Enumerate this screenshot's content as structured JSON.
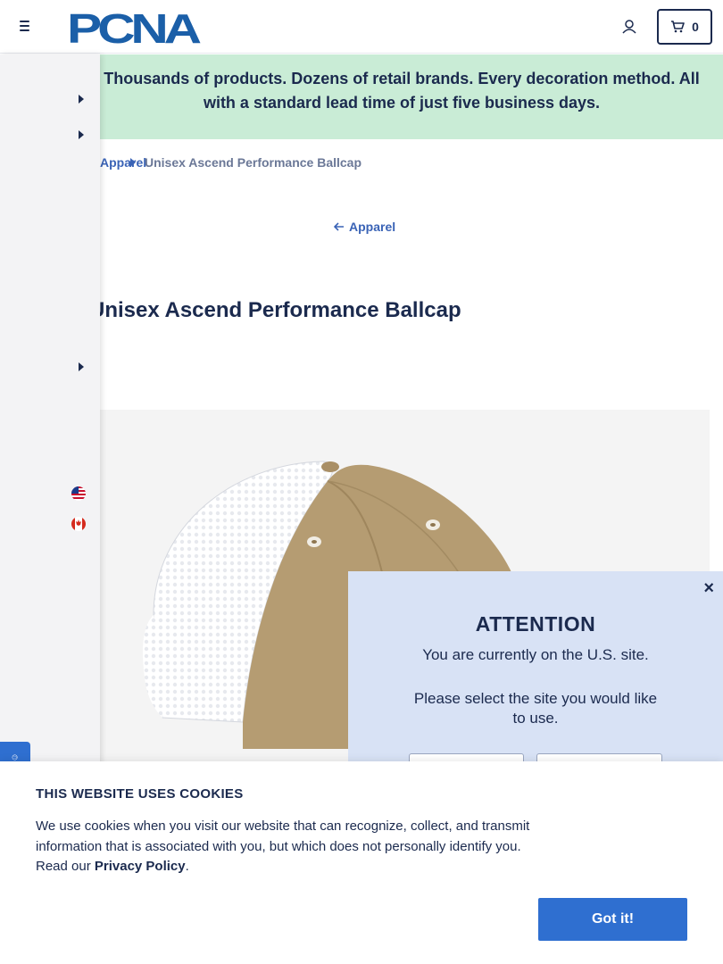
{
  "header": {
    "logo_text": "PCNA",
    "cart_count": "0"
  },
  "banner": {
    "text": "Thousands of products. Dozens of retail brands. Every decoration method. All with a standard lead time of just five business days."
  },
  "breadcrumb": {
    "parent": "Apparel",
    "current": "Unisex Ascend Performance Ballcap"
  },
  "back_link": {
    "label": "Apparel"
  },
  "product": {
    "title": "Unisex Ascend Performance Ballcap"
  },
  "modal": {
    "close_label": "×",
    "title": "ATTENTION",
    "line1": "You are currently on the U.S. site.",
    "line2": "Please select the site you would like to use."
  },
  "cookie": {
    "title": "THIS WEBSITE USES COOKIES",
    "text": "We use cookies when you visit our website that can recognize, collect, and transmit information that is associated with you, but which does not personally identify you. Read our ",
    "link": "Privacy Policy",
    "period": ".",
    "button": "Got it!"
  },
  "colors": {
    "brand_navy": "#1b2a4e",
    "link_blue": "#3a63b6",
    "banner_green": "#c9ecd6",
    "modal_bg": "#d8e2f5",
    "button_blue": "#2f6fd0"
  },
  "icons": [
    "menu-icon",
    "account-icon",
    "cart-icon",
    "chevron-right-icon",
    "arrow-left-icon",
    "us-flag-icon",
    "canada-flag-icon",
    "close-icon"
  ]
}
